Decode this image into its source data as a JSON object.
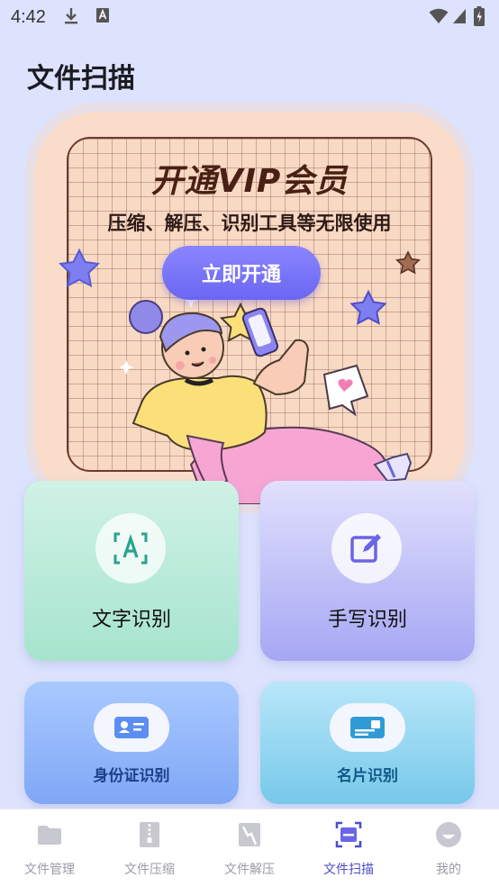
{
  "status_bar": {
    "time": "4:42"
  },
  "page": {
    "title": "文件扫描"
  },
  "banner": {
    "title": "开通VIP会员",
    "subtitle": "压缩、解压、识别工具等无限使用",
    "button_label": "立即开通"
  },
  "features": {
    "ocr": {
      "label": "文字识别",
      "icon": "text-recognition-icon"
    },
    "handwriting": {
      "label": "手写识别",
      "icon": "edit-icon"
    },
    "id_card": {
      "label": "身份证识别",
      "icon": "id-card-icon"
    },
    "business_card": {
      "label": "名片识别",
      "icon": "business-card-icon"
    }
  },
  "bottom_nav": {
    "items": [
      {
        "label": "文件管理",
        "icon": "folder-icon",
        "active": false
      },
      {
        "label": "文件压缩",
        "icon": "zip-icon",
        "active": false
      },
      {
        "label": "文件解压",
        "icon": "unzip-icon",
        "active": false
      },
      {
        "label": "文件扫描",
        "icon": "scan-icon",
        "active": true
      },
      {
        "label": "我的",
        "icon": "profile-icon",
        "active": false
      }
    ]
  },
  "colors": {
    "accent": "#5f5be8",
    "background": "#dde3fd",
    "banner_bg": "#f9ddca",
    "nav_inactive": "#9a9aa6"
  }
}
